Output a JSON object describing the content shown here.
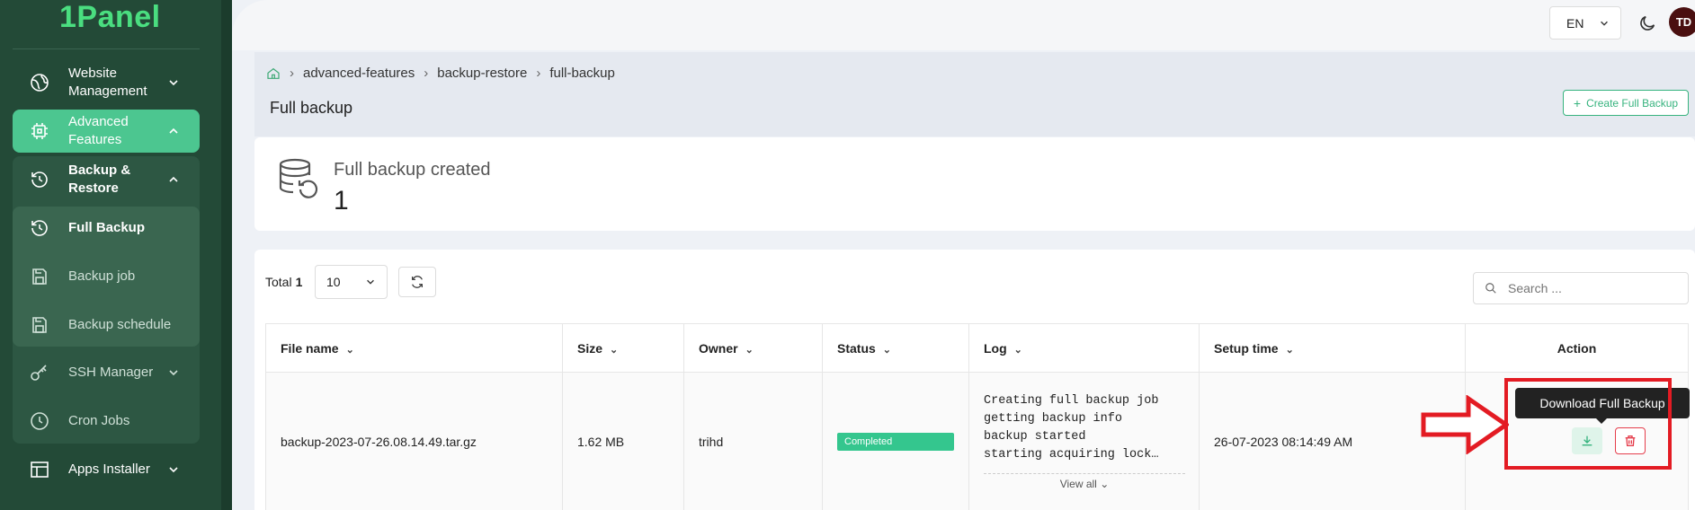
{
  "app": {
    "logo": "1Panel"
  },
  "sidebar": {
    "items": [
      {
        "label": "Website Management",
        "icon": "globe-icon"
      },
      {
        "label": "Advanced Features",
        "icon": "cpu-icon"
      },
      {
        "label": "Backup & Restore",
        "icon": "history-icon"
      },
      {
        "label": "Full Backup",
        "icon": "history-icon"
      },
      {
        "label": "Backup job",
        "icon": "save-icon"
      },
      {
        "label": "Backup schedule",
        "icon": "save-icon"
      },
      {
        "label": "SSH Manager",
        "icon": "key-icon"
      },
      {
        "label": "Cron Jobs",
        "icon": "clock-icon"
      },
      {
        "label": "Apps Installer",
        "icon": "grid-icon"
      }
    ]
  },
  "topbar": {
    "language": "EN",
    "avatar_initials": "TD"
  },
  "breadcrumb": [
    "advanced-features",
    "backup-restore",
    "full-backup"
  ],
  "page": {
    "title": "Full backup",
    "create_button": "Create Full Backup"
  },
  "stats": {
    "label": "Full backup created",
    "value": "1"
  },
  "toolbar": {
    "total_label": "Total",
    "total_value": "1",
    "page_size": "10",
    "search_placeholder": "Search ..."
  },
  "table": {
    "headers": [
      "File name",
      "Size",
      "Owner",
      "Status",
      "Log",
      "Setup time",
      "Action"
    ],
    "rows": [
      {
        "file_name": "backup-2023-07-26.08.14.49.tar.gz",
        "size": "1.62 MB",
        "owner": "trihd",
        "status": "Completed",
        "log": "Creating full backup job\ngetting backup info\nbackup started\nstarting acquiring lock…",
        "view_all": "View all",
        "setup_time": "26-07-2023 08:14:49 AM"
      }
    ]
  },
  "tooltip": "Download Full Backup",
  "colors": {
    "sidebar_bg": "#234a37",
    "accent": "#4cc690",
    "status_completed": "#34c68e",
    "danger": "#e53e4c",
    "annotation": "#e31b23"
  }
}
